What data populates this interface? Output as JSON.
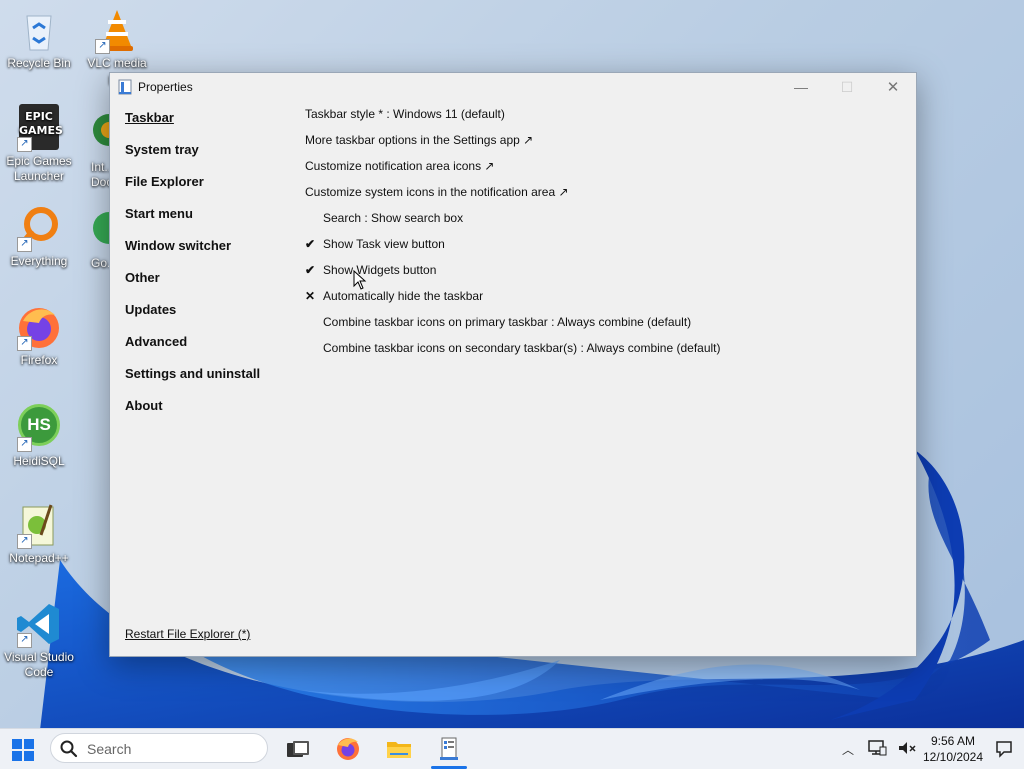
{
  "desktop": {
    "icons": [
      {
        "name": "recycle-bin",
        "label": "Recycle Bin"
      },
      {
        "name": "vlc",
        "label": "VLC media p..."
      },
      {
        "name": "epic-games",
        "label": "Epic Games Launcher",
        "logo_text": "EPIC GAMES"
      },
      {
        "name": "intel-doc",
        "label": "Int... Doc..."
      },
      {
        "name": "everything",
        "label": "Everything"
      },
      {
        "name": "go",
        "label": "Go..."
      },
      {
        "name": "firefox",
        "label": "Firefox"
      },
      {
        "name": "heidisql",
        "label": "HeidiSQL",
        "logo_text": "HS"
      },
      {
        "name": "notepadpp",
        "label": "Notepad++"
      },
      {
        "name": "vscode",
        "label": "Visual Studio Code"
      }
    ]
  },
  "window": {
    "title": "Properties",
    "controls": {
      "minimize": "—",
      "maximize": "☐",
      "close": "✕"
    },
    "nav": [
      "Taskbar",
      "System tray",
      "File Explorer",
      "Start menu",
      "Window switcher",
      "Other",
      "Updates",
      "Advanced",
      "Settings and uninstall",
      "About"
    ],
    "active_nav": "Taskbar",
    "options": [
      {
        "label": "Taskbar style * : Windows 11 (default)",
        "mark": "",
        "indent": false
      },
      {
        "label": "More taskbar options in the Settings app ↗",
        "mark": "",
        "indent": false
      },
      {
        "label": "Customize notification area icons ↗",
        "mark": "",
        "indent": false
      },
      {
        "label": "Customize system icons in the notification area ↗",
        "mark": "",
        "indent": false
      },
      {
        "label": "Search : Show search box",
        "mark": "",
        "indent": true
      },
      {
        "label": "Show Task view button",
        "mark": "✔",
        "indent": true
      },
      {
        "label": "Show Widgets button",
        "mark": "✔",
        "indent": true
      },
      {
        "label": "Automatically hide the taskbar",
        "mark": "✕",
        "indent": true
      },
      {
        "label": "Combine taskbar icons on primary taskbar : Always combine (default)",
        "mark": "",
        "indent": true
      },
      {
        "label": "Combine taskbar icons on secondary taskbar(s) : Always combine (default)",
        "mark": "",
        "indent": true
      }
    ],
    "restart_link": "Restart File Explorer (*)"
  },
  "taskbar": {
    "search_placeholder": "Search",
    "apps": [
      "task-view",
      "firefox",
      "file-explorer",
      "properties"
    ],
    "active_app": "properties",
    "clock": {
      "time": "9:56 AM",
      "date": "12/10/2024"
    },
    "accent": "#1a73e8"
  }
}
